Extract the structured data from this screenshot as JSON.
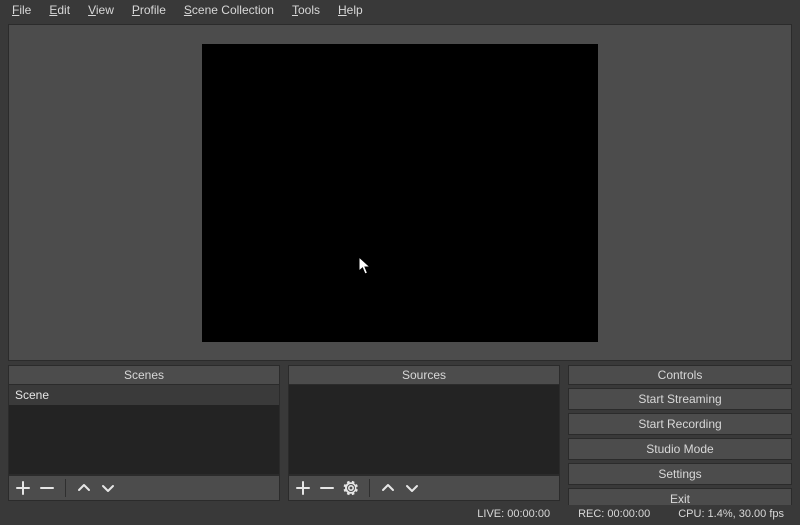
{
  "menu": {
    "file": "File",
    "edit": "Edit",
    "view": "View",
    "profile": "Profile",
    "scene_collection": "Scene Collection",
    "tools": "Tools",
    "help": "Help"
  },
  "panels": {
    "scenes_header": "Scenes",
    "sources_header": "Sources",
    "controls_header": "Controls"
  },
  "scenes": {
    "items": [
      {
        "label": "Scene"
      }
    ]
  },
  "sources": {
    "items": []
  },
  "controls": {
    "start_streaming": "Start Streaming",
    "start_recording": "Start Recording",
    "studio_mode": "Studio Mode",
    "settings": "Settings",
    "exit": "Exit"
  },
  "status": {
    "live": "LIVE: 00:00:00",
    "rec": "REC: 00:00:00",
    "cpu": "CPU: 1.4%, 30.00 fps"
  },
  "icons": {
    "plus": "plus-icon",
    "minus": "minus-icon",
    "up": "chevron-up-icon",
    "down": "chevron-down-icon",
    "gear": "gear-icon"
  }
}
